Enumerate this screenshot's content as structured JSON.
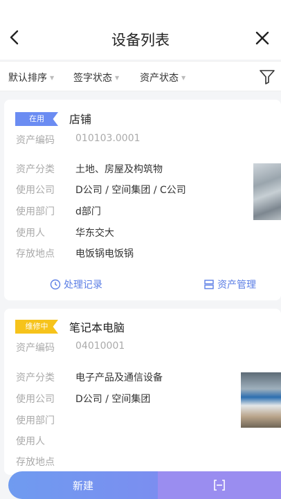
{
  "header": {
    "title": "设备列表"
  },
  "filters": [
    {
      "label": "默认排序"
    },
    {
      "label": "签字状态"
    },
    {
      "label": "资产状态"
    }
  ],
  "cards": [
    {
      "badge": "在用",
      "badge_color": "#6b8cf2",
      "name": "店铺",
      "code_label": "资产编码",
      "code": "010103.0001",
      "fields": [
        {
          "label": "资产分类",
          "value": "土地、房屋及构筑物"
        },
        {
          "label": "使用公司",
          "value": "D公司 / 空间集团 / C公司"
        },
        {
          "label": "使用部门",
          "value": "d部门"
        },
        {
          "label": "使用人",
          "value": "华东交大"
        },
        {
          "label": "存放地点",
          "value": "电饭锅电饭锅"
        }
      ],
      "actions": {
        "record": "处理记录",
        "manage": "资产管理"
      }
    },
    {
      "badge": "维修中",
      "badge_color": "#f6c31b",
      "name": "笔记本电脑",
      "code_label": "资产编码",
      "code": "04010001",
      "fields": [
        {
          "label": "资产分类",
          "value": "电子产品及通信设备"
        },
        {
          "label": "使用公司",
          "value": "D公司 / 空间集团"
        },
        {
          "label": "使用部门",
          "value": ""
        },
        {
          "label": "使用人",
          "value": ""
        },
        {
          "label": "存放地点",
          "value": ""
        }
      ]
    }
  ],
  "bottom": {
    "new_label": "新建"
  }
}
